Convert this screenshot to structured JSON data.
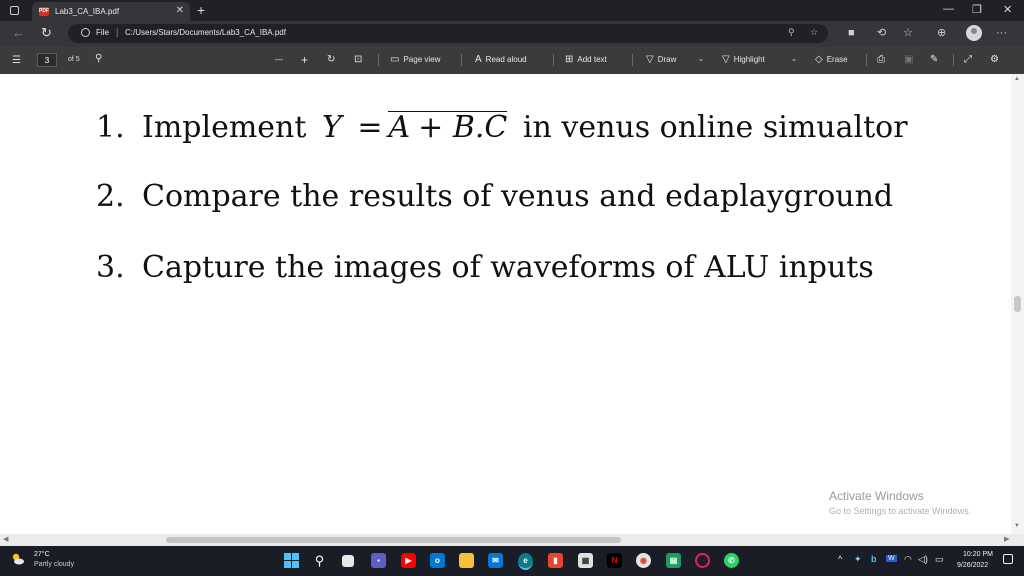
{
  "tab": {
    "title": "Lab3_CA_IBA.pdf",
    "badge": "PDF"
  },
  "address": {
    "scheme": "File",
    "separator": "|",
    "path": "C:/Users/Stars/Documents/Lab3_CA_IBA.pdf"
  },
  "pdf_toolbar": {
    "page_current": "3",
    "page_total": "of 5",
    "page_view": "Page view",
    "read_aloud": "Read aloud",
    "add_text": "Add text",
    "draw": "Draw",
    "highlight": "Highlight",
    "erase": "Erase"
  },
  "document": {
    "items": [
      {
        "number": "1.",
        "before": "Implement",
        "formula_lhs": "Y",
        "formula_eq": "=",
        "formula_bar": "A",
        "formula_rest": "+ B.C",
        "after": "in venus online simualtor"
      },
      {
        "number": "2.",
        "text": "Compare the results of venus and edaplayground"
      },
      {
        "number": "3.",
        "text": "Capture the images of waveforms of ALU inputs"
      }
    ]
  },
  "watermark": {
    "title": "Activate Windows",
    "subtitle": "Go to Settings to activate Windows."
  },
  "taskbar": {
    "temperature": "27°C",
    "condition": "Partly cloudy",
    "time": "10:20 PM",
    "date": "9/26/2022"
  },
  "colors": {
    "taskbar": "#1a1d26",
    "toolbar": "#3b3b3b",
    "tabbar": "#202124",
    "accent": "#0078d4"
  }
}
